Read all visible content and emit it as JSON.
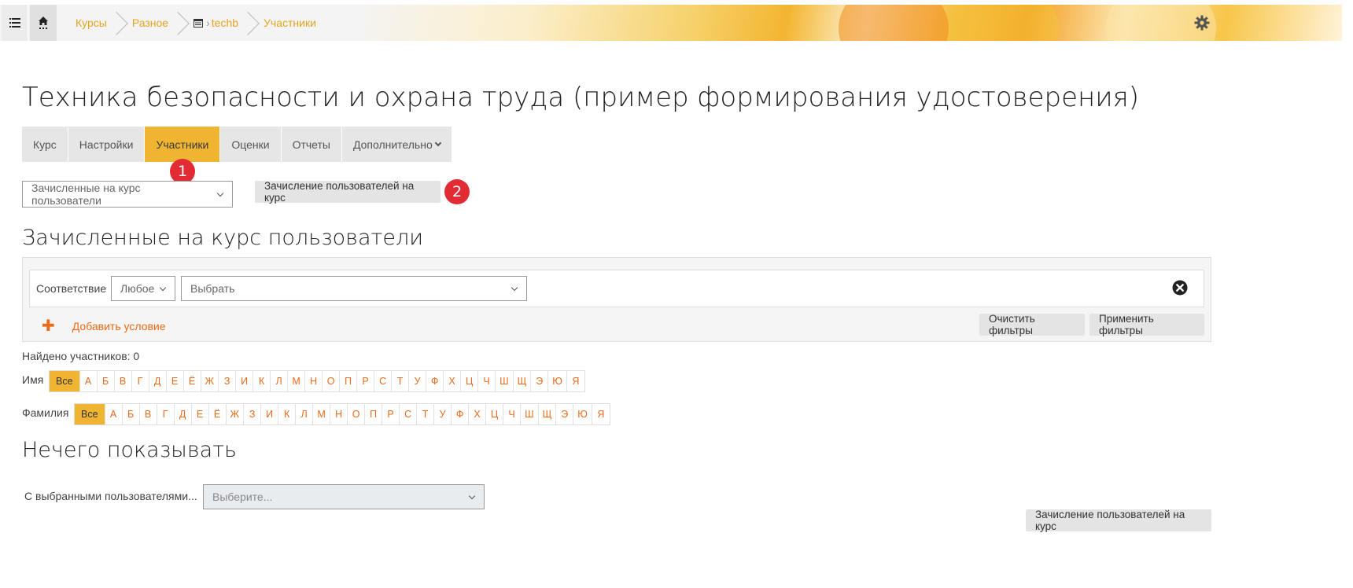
{
  "breadcrumb": {
    "items": [
      "Курсы",
      "Разное",
      "techb",
      "Участники"
    ]
  },
  "page": {
    "title": "Техника безопасности и охрана труда (пример формирования удостоверения)"
  },
  "tabs": [
    {
      "label": "Курс",
      "active": false
    },
    {
      "label": "Настройки",
      "active": false
    },
    {
      "label": "Участники",
      "active": true
    },
    {
      "label": "Оценки",
      "active": false
    },
    {
      "label": "Отчеты",
      "active": false
    },
    {
      "label": "Дополнительно",
      "active": false
    }
  ],
  "badges": {
    "first": "1",
    "second": "2"
  },
  "view_select": {
    "value": "Зачисленные на курс пользователи"
  },
  "enrol_button": {
    "label": "Зачисление пользователей на курс"
  },
  "section_title": "Зачисленные на курс пользователи",
  "filters": {
    "match_label": "Соответствие",
    "match_value": "Любое",
    "condition_value": "Выбрать",
    "add_condition": "Добавить условие",
    "clear_label": "Очистить фильтры",
    "apply_label": "Применить фильтры"
  },
  "found_text": "Найдено участников: 0",
  "initials": {
    "first_label": "Имя",
    "last_label": "Фамилия",
    "all": "Все",
    "letters": [
      "А",
      "Б",
      "В",
      "Г",
      "Д",
      "Е",
      "Ё",
      "Ж",
      "З",
      "И",
      "К",
      "Л",
      "М",
      "Н",
      "О",
      "П",
      "Р",
      "С",
      "Т",
      "У",
      "Ф",
      "Х",
      "Ц",
      "Ч",
      "Ш",
      "Щ",
      "Э",
      "Ю",
      "Я"
    ]
  },
  "empty_text": "Нечего показывать",
  "bulk": {
    "label": "С выбранными пользователями...",
    "placeholder": "Выберите..."
  },
  "colors": {
    "accent": "#f0b433",
    "link": "#e86a1a",
    "badge": "#e22b33"
  }
}
